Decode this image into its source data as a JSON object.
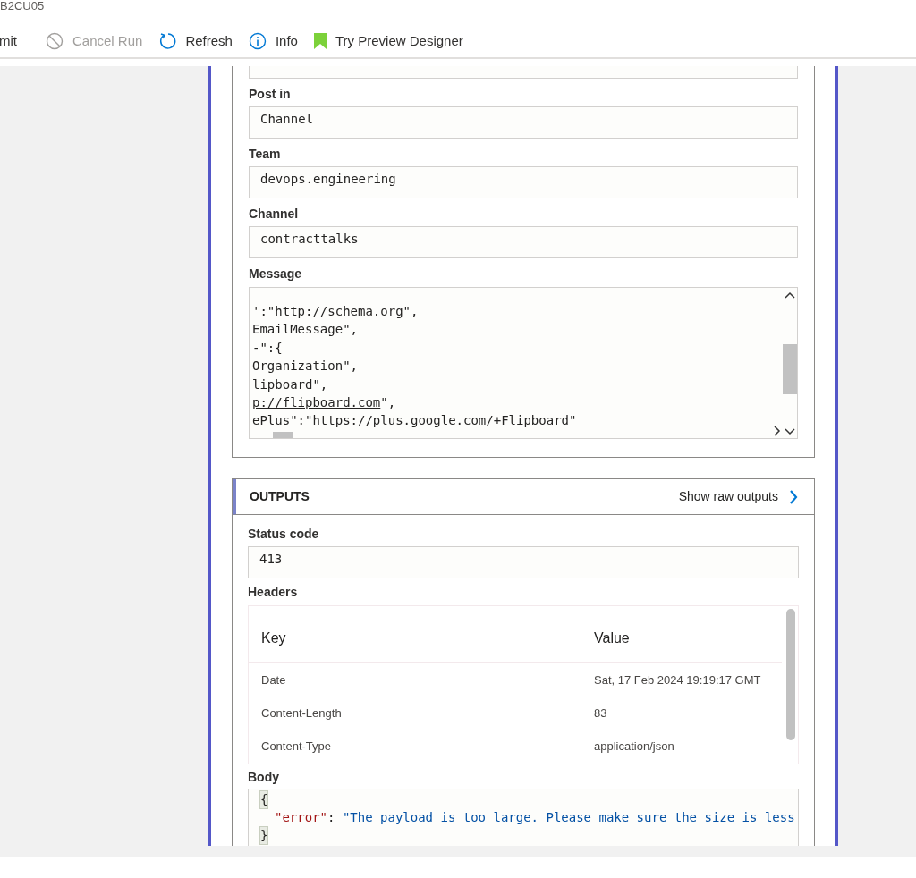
{
  "window": {
    "title": "B2CU05"
  },
  "toolbar": [
    {
      "label": "mit",
      "kind": "plain",
      "disabled": false
    },
    {
      "label": "Cancel Run",
      "kind": "cancel",
      "disabled": true
    },
    {
      "label": "Refresh",
      "kind": "refresh",
      "disabled": false
    },
    {
      "label": "Info",
      "kind": "info",
      "disabled": false
    },
    {
      "label": "Try Preview Designer",
      "kind": "preview",
      "disabled": false
    }
  ],
  "inputs": {
    "fields": [
      {
        "label": "Post in",
        "value": "Channel"
      },
      {
        "label": "Team",
        "value": "devops.engineering"
      },
      {
        "label": "Channel",
        "value": "contracttalks"
      }
    ],
    "message": {
      "label": "Message",
      "lines": [
        [
          {
            "text": "':\"",
            "link": false
          },
          {
            "text": "http://schema.org",
            "link": true
          },
          {
            "text": "\",",
            "link": false
          }
        ],
        [
          {
            "text": "EmailMessage\",",
            "link": false
          }
        ],
        [
          {
            "text": "-\":{",
            "link": false
          }
        ],
        [
          {
            "text": "Organization\",",
            "link": false
          }
        ],
        [
          {
            "text": "lipboard\",",
            "link": false
          }
        ],
        [
          {
            "text": "p://flipboard.com",
            "link": true
          },
          {
            "text": "\",",
            "link": false
          }
        ],
        [
          {
            "text": "ePlus\":\"",
            "link": false
          },
          {
            "text": "https://plus.google.com/+Flipboard",
            "link": true
          },
          {
            "text": "\"",
            "link": false
          }
        ]
      ]
    }
  },
  "outputs": {
    "title": "OUTPUTS",
    "raw_link": "Show raw outputs",
    "status": {
      "label": "Status code",
      "value": "413"
    },
    "headers": {
      "label": "Headers",
      "columns": [
        "Key",
        "Value"
      ],
      "rows": [
        [
          "Date",
          "Sat, 17 Feb 2024 19:19:17 GMT"
        ],
        [
          "Content-Length",
          "83"
        ],
        [
          "Content-Type",
          "application/json"
        ]
      ]
    },
    "body": {
      "label": "Body",
      "lines": [
        {
          "kind": "brace",
          "text": "{"
        },
        {
          "kind": "pair",
          "key": "\"error\"",
          "separator": ": ",
          "value": "\"The payload is too large. Please make sure the size is less"
        },
        {
          "kind": "brace",
          "text": "}"
        }
      ]
    }
  }
}
